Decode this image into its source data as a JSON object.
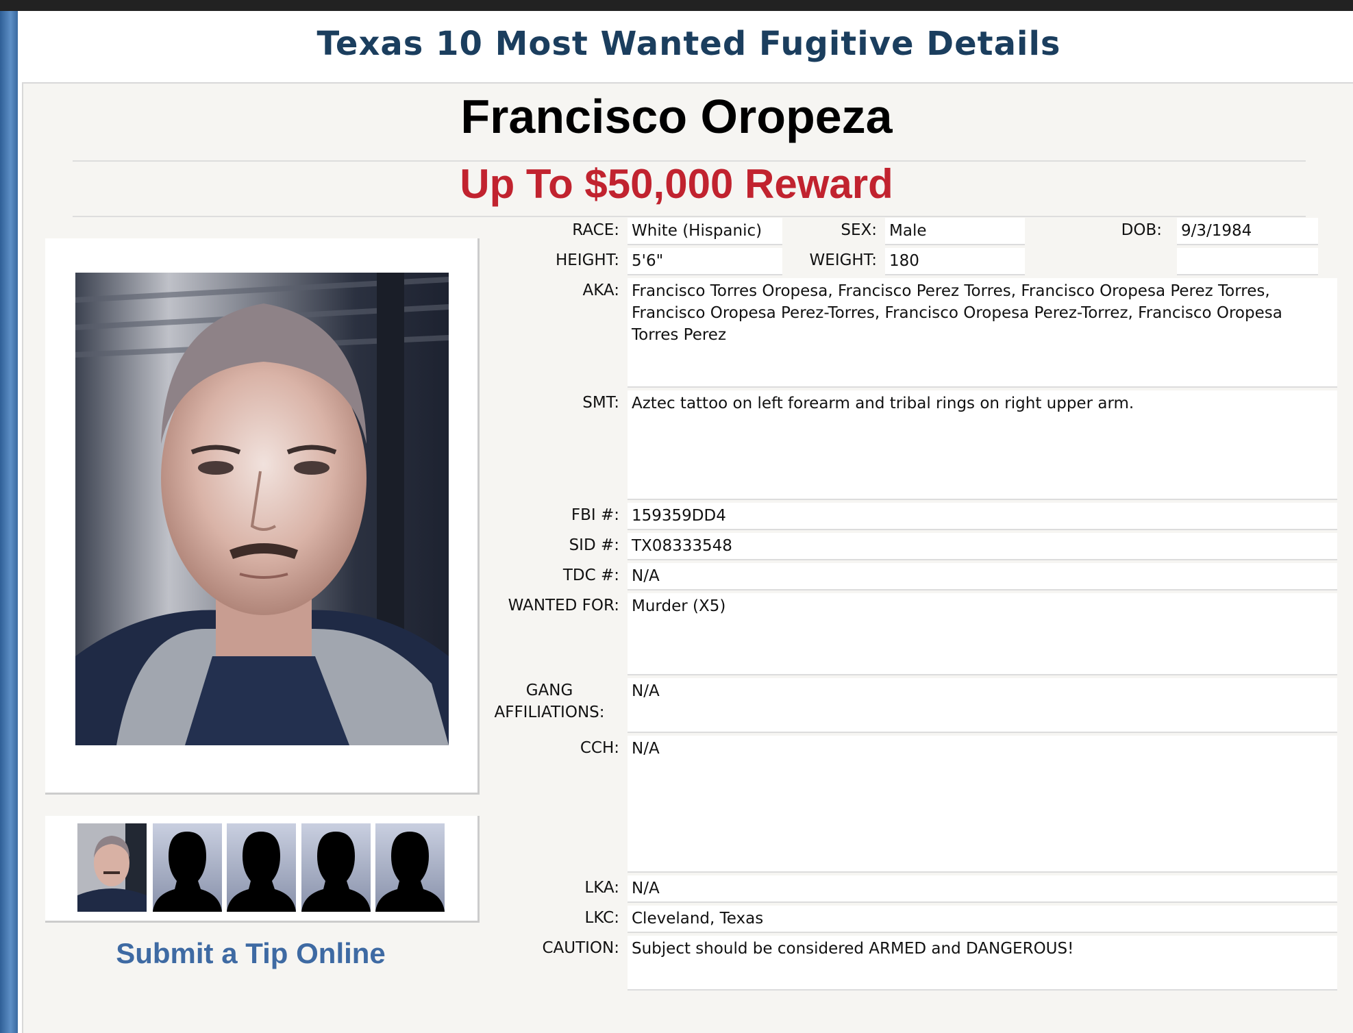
{
  "page_title": "Texas 10 Most Wanted Fugitive Details",
  "fugitive": {
    "name": "Francisco Oropeza",
    "reward": "Up To $50,000 Reward"
  },
  "fields": {
    "race": {
      "label": "RACE:",
      "value": "White (Hispanic)"
    },
    "sex": {
      "label": "SEX:",
      "value": "Male"
    },
    "dob": {
      "label": "DOB:",
      "value": "9/3/1984"
    },
    "height": {
      "label": "HEIGHT:",
      "value": "5'6\""
    },
    "weight": {
      "label": "WEIGHT:",
      "value": "180"
    },
    "aka": {
      "label": "AKA:",
      "value": "Francisco Torres Oropesa, Francisco Perez Torres, Francisco Oropesa Perez Torres, Francisco Oropesa Perez-Torres, Francisco Oropesa Perez-Torrez, Francisco Oropesa Torres Perez"
    },
    "smt": {
      "label": "SMT:",
      "value": "Aztec tattoo on left forearm and tribal rings on right upper arm."
    },
    "fbi": {
      "label": "FBI #:",
      "value": "159359DD4"
    },
    "sid": {
      "label": "SID #:",
      "value": "TX08333548"
    },
    "tdc": {
      "label": "TDC #:",
      "value": "N/A"
    },
    "wanted_for": {
      "label": "WANTED FOR:",
      "value": "Murder (X5)"
    },
    "gang": {
      "label_line1": "GANG",
      "label_line2": "AFFILIATIONS:",
      "value": "N/A"
    },
    "cch": {
      "label": "CCH:",
      "value": "N/A"
    },
    "lka": {
      "label": "LKA:",
      "value": "N/A"
    },
    "lkc": {
      "label": "LKC:",
      "value": "Cleveland, Texas"
    },
    "caution": {
      "label": "CAUTION:",
      "value": "Subject should be considered ARMED and DANGEROUS!"
    }
  },
  "tip_link": "Submit a Tip Online",
  "icons": {
    "main_photo": "mugshot-photo",
    "thumb_1": "mugshot-thumbnail",
    "thumbs_placeholder": "silhouette-placeholder-icon"
  },
  "colors": {
    "title": "#1b3e5e",
    "reward": "#c1232f",
    "link": "#3e6aa3",
    "panel_bg": "#f6f5f2"
  }
}
